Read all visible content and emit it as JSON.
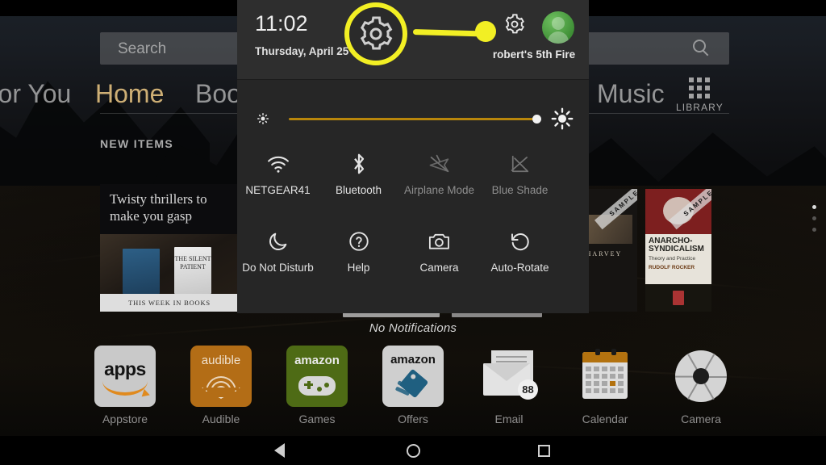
{
  "device": {
    "platform": "Amazon Fire tablet",
    "statusbar_color": "#000000"
  },
  "home": {
    "search": {
      "placeholder": "Search",
      "icon": "search-icon"
    },
    "tabs": [
      {
        "label": "For You",
        "selected": false
      },
      {
        "label": "Home",
        "selected": true
      },
      {
        "label": "Book",
        "selected": false
      },
      {
        "label": "Music",
        "selected": false
      }
    ],
    "library_button": {
      "label": "LIBRARY",
      "icon": "grid-icon"
    },
    "section_header": "NEW ITEMS",
    "cards": [
      {
        "title": "Twisty thrillers to make you gasp",
        "footer": "THIS WEEK IN BOOKS",
        "book_cover_text": "THE SILENT PATIENT"
      },
      {
        "badge": "SAMPLE",
        "author": "HARVEY"
      },
      {
        "badge": "SAMPLE",
        "title_line1": "ANARCHO-",
        "title_line2": "SYNDICALISM",
        "subtitle": "Theory and Practice",
        "author": "RUDOLF ROCKER"
      }
    ]
  },
  "dock": {
    "items": [
      {
        "label": "Appstore",
        "icon": "appstore-icon",
        "wordmark": "apps",
        "badge": null
      },
      {
        "label": "Audible",
        "icon": "audible-icon",
        "wordmark": "audible",
        "badge": null
      },
      {
        "label": "Games",
        "icon": "games-icon",
        "wordmark": "amazon",
        "badge": null
      },
      {
        "label": "Offers",
        "icon": "offers-icon",
        "wordmark": "amazon",
        "badge": null
      },
      {
        "label": "Email",
        "icon": "email-icon",
        "wordmark": "",
        "badge": "88"
      },
      {
        "label": "Calendar",
        "icon": "calendar-icon",
        "wordmark": "",
        "badge": null
      },
      {
        "label": "Camera",
        "icon": "camera-icon",
        "wordmark": "",
        "badge": null
      }
    ]
  },
  "quick_settings": {
    "time": "11:02",
    "date": "Thursday, April 25",
    "device_name": "robert's 5th Fire",
    "settings_gear_icon": "gear-icon",
    "avatar_icon": "user-avatar-icon",
    "brightness": {
      "low_icon": "brightness-low-icon",
      "high_icon": "brightness-high-icon",
      "value_percent": 93,
      "track_color": "#b8860b"
    },
    "toggles": [
      {
        "label": "NETGEAR41",
        "icon": "wifi-icon",
        "enabled": true
      },
      {
        "label": "Bluetooth",
        "icon": "bluetooth-icon",
        "enabled": true
      },
      {
        "label": "Airplane Mode",
        "icon": "airplane-off-icon",
        "enabled": false
      },
      {
        "label": "Blue Shade",
        "icon": "blue-shade-off-icon",
        "enabled": false
      },
      {
        "label": "Do Not Disturb",
        "icon": "moon-icon",
        "enabled": true
      },
      {
        "label": "Help",
        "icon": "help-icon",
        "enabled": true
      },
      {
        "label": "Camera",
        "icon": "camera-icon",
        "enabled": true
      },
      {
        "label": "Auto-Rotate",
        "icon": "rotate-icon",
        "enabled": true
      }
    ],
    "notifications_text": "No Notifications"
  },
  "annotation": {
    "color": "#f2ef24",
    "target_icon": "gear-icon",
    "style": "callout-circle-with-line"
  },
  "navbar": {
    "buttons": [
      {
        "label": "Back",
        "icon": "back-triangle-icon"
      },
      {
        "label": "Home",
        "icon": "home-circle-icon"
      },
      {
        "label": "Recents",
        "icon": "recents-square-icon"
      }
    ]
  }
}
